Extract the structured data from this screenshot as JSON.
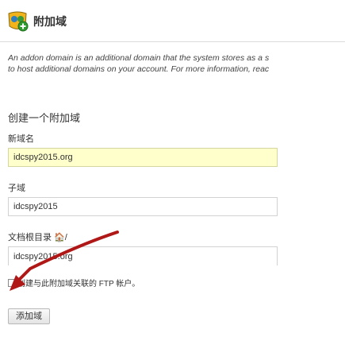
{
  "header": {
    "title": "附加域"
  },
  "description": {
    "line1": "An addon domain is an additional domain that the system stores as a s",
    "line2": "to host additional domains on your account. For more information, reac"
  },
  "form": {
    "section_title": "创建一个附加域",
    "new_domain": {
      "label": "新域名",
      "value": "idcspy2015.org"
    },
    "subdomain": {
      "label": "子域",
      "value": "idcspy2015"
    },
    "docroot": {
      "label": "文档根目录 🏠/",
      "value": "idcspy2015.org"
    },
    "hint": "创建与此附加域关联的 FTP 帐户。",
    "submit_label": "添加域"
  },
  "colors": {
    "focused_input_bg": "#ffffcc",
    "arrow": "#b01818"
  }
}
